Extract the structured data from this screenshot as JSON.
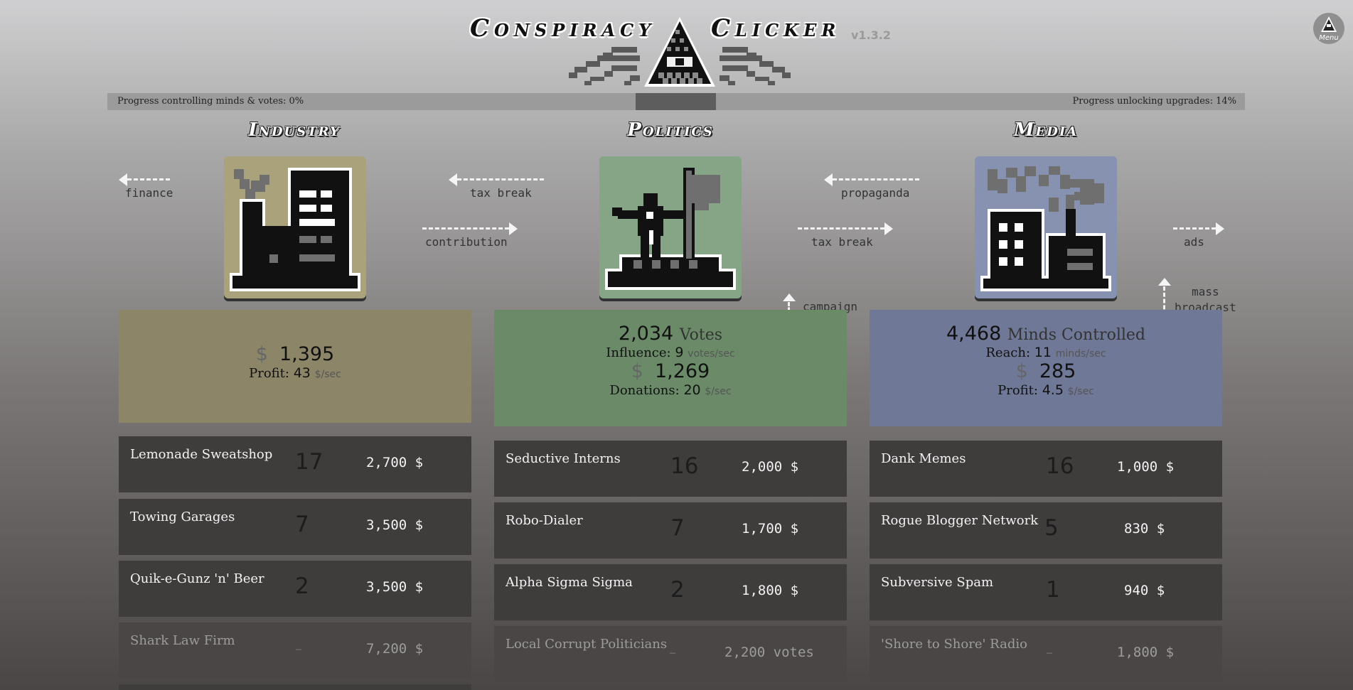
{
  "header": {
    "title_left": "Conspiracy",
    "title_right": "Clicker",
    "version": "v1.3.2",
    "menu_label": "Menu"
  },
  "progress": {
    "left_label": "Progress controlling minds & votes:",
    "left_value": "0%",
    "right_label": "Progress unlocking upgrades:",
    "right_value": "14%"
  },
  "sections": {
    "industry": "Industry",
    "politics": "Politics",
    "media": "Media"
  },
  "arrows": {
    "finance": "finance",
    "tax_break_1": "tax break",
    "contribution": "contribution",
    "propaganda": "propaganda",
    "tax_break_2": "tax break",
    "campaign": "campaign",
    "ads": "ads",
    "mass_broadcast": "mass\nbroadcast"
  },
  "industry": {
    "currency": "$",
    "money": "1,395",
    "profit_label": "Profit:",
    "profit": "43",
    "profit_unit": "$/sec",
    "upgrades": [
      {
        "name": "Lemonade Sweatshop",
        "count": "17",
        "price": "2,700 $",
        "locked": false
      },
      {
        "name": "Towing Garages",
        "count": "7",
        "price": "3,500 $",
        "locked": false
      },
      {
        "name": "Quik-e-Gunz 'n' Beer",
        "count": "2",
        "price": "3,500 $",
        "locked": false
      },
      {
        "name": "Shark Law Firm",
        "count": "–",
        "price": "7,200 $",
        "locked": true
      }
    ]
  },
  "politics": {
    "votes": "2,034",
    "votes_label": "Votes",
    "influence_label": "Influence:",
    "influence": "9",
    "influence_unit": "votes/sec",
    "currency": "$",
    "money": "1,269",
    "donations_label": "Donations:",
    "donations": "20",
    "donations_unit": "$/sec",
    "upgrades": [
      {
        "name": "Seductive Interns",
        "count": "16",
        "price": "2,000 $",
        "locked": false
      },
      {
        "name": "Robo-Dialer",
        "count": "7",
        "price": "1,700 $",
        "locked": false
      },
      {
        "name": "Alpha Sigma Sigma",
        "count": "2",
        "price": "1,800 $",
        "locked": false
      },
      {
        "name": "Local Corrupt Politicians",
        "count": "–",
        "price": "2,200 votes",
        "locked": true
      }
    ]
  },
  "media": {
    "minds": "4,468",
    "minds_label": "Minds Controlled",
    "reach_label": "Reach:",
    "reach": "11",
    "reach_unit": "minds/sec",
    "currency": "$",
    "money": "285",
    "profit_label": "Profit:",
    "profit": "4.5",
    "profit_unit": "$/sec",
    "upgrades": [
      {
        "name": "Dank Memes",
        "count": "16",
        "price": "1,000 $",
        "locked": false
      },
      {
        "name": "Rogue Blogger Network",
        "count": "5",
        "price": "830 $",
        "locked": false
      },
      {
        "name": "Subversive Spam",
        "count": "1",
        "price": "940 $",
        "locked": false
      },
      {
        "name": "'Shore to Shore' Radio",
        "count": "–",
        "price": "1,800 $",
        "locked": true
      }
    ]
  },
  "colors": {
    "industry_panel": "#8c8568",
    "politics_panel": "#6a8a68",
    "media_panel": "#6f7896",
    "industry_tile": "#a9a27a",
    "politics_tile": "#86a586",
    "media_tile": "#8791b0",
    "row_bg": "#3f3c3c"
  },
  "icons": {
    "logo": "illuminati-pyramid-icon",
    "menu": "pyramid-menu-icon",
    "industry": "factory-building-icon",
    "politics": "politician-with-flag-icon",
    "media": "broadcast-city-icon"
  }
}
